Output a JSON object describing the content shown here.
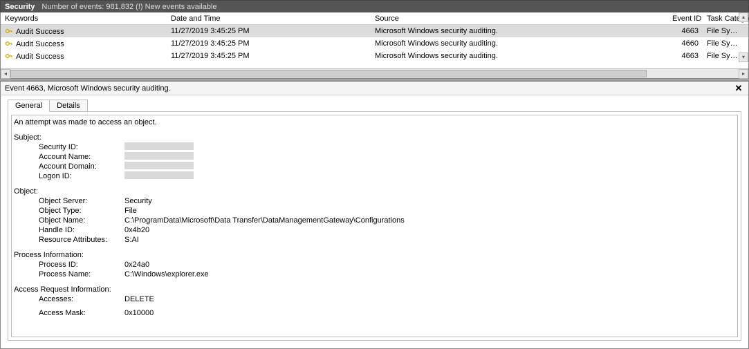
{
  "titlebar": {
    "name": "Security",
    "count_text": "Number of events: 981,832 (!) New events available"
  },
  "grid": {
    "headers": {
      "keywords": "Keywords",
      "datetime": "Date and Time",
      "source": "Source",
      "eventid": "Event ID",
      "taskcat": "Task Category"
    },
    "rows": [
      {
        "keywords": "Audit Success",
        "datetime": "11/27/2019 3:45:25 PM",
        "source": "Microsoft Windows security auditing.",
        "eventid": "4663",
        "taskcat": "File System",
        "selected": true
      },
      {
        "keywords": "Audit Success",
        "datetime": "11/27/2019 3:45:25 PM",
        "source": "Microsoft Windows security auditing.",
        "eventid": "4660",
        "taskcat": "File System",
        "selected": false
      },
      {
        "keywords": "Audit Success",
        "datetime": "11/27/2019 3:45:25 PM",
        "source": "Microsoft Windows security auditing.",
        "eventid": "4663",
        "taskcat": "File System",
        "selected": false
      }
    ]
  },
  "detail": {
    "title": "Event 4663, Microsoft Windows security auditing.",
    "tabs": {
      "general": "General",
      "details": "Details"
    },
    "lead": "An attempt was made to access an object.",
    "sections": {
      "subject_title": "Subject:",
      "subject": {
        "security_id_k": "Security ID:",
        "account_name_k": "Account Name:",
        "account_domain_k": "Account Domain:",
        "logon_id_k": "Logon ID:"
      },
      "object_title": "Object:",
      "object": {
        "object_server_k": "Object Server:",
        "object_server_v": "Security",
        "object_type_k": "Object Type:",
        "object_type_v": "File",
        "object_name_k": "Object Name:",
        "object_name_v": "C:\\ProgramData\\Microsoft\\Data Transfer\\DataManagementGateway\\Configurations",
        "handle_id_k": "Handle ID:",
        "handle_id_v": "0x4b20",
        "resource_attr_k": "Resource Attributes:",
        "resource_attr_v": "S:AI"
      },
      "process_title": "Process Information:",
      "process": {
        "process_id_k": "Process ID:",
        "process_id_v": "0x24a0",
        "process_name_k": "Process Name:",
        "process_name_v": "C:\\Windows\\explorer.exe"
      },
      "access_title": "Access Request Information:",
      "access": {
        "accesses_k": "Accesses:",
        "accesses_v": "DELETE",
        "access_mask_k": "Access Mask:",
        "access_mask_v": "0x10000"
      }
    }
  }
}
